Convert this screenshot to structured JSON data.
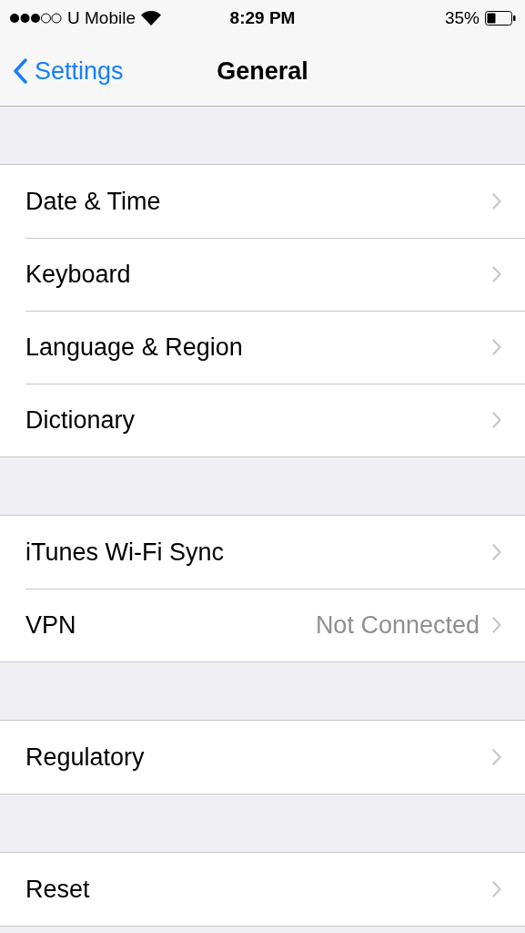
{
  "status_bar": {
    "carrier": "U Mobile",
    "time": "8:29 PM",
    "battery": "35%"
  },
  "nav": {
    "back": "Settings",
    "title": "General"
  },
  "groups": [
    {
      "items": [
        {
          "label": "Date & Time"
        },
        {
          "label": "Keyboard"
        },
        {
          "label": "Language & Region"
        },
        {
          "label": "Dictionary"
        }
      ]
    },
    {
      "items": [
        {
          "label": "iTunes Wi-Fi Sync"
        },
        {
          "label": "VPN",
          "value": "Not Connected"
        }
      ]
    },
    {
      "items": [
        {
          "label": "Regulatory"
        }
      ]
    },
    {
      "items": [
        {
          "label": "Reset"
        }
      ]
    }
  ]
}
